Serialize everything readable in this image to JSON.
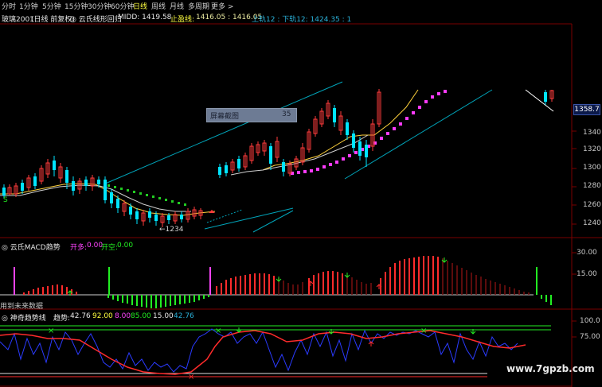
{
  "menu": {
    "items": [
      "分时",
      "1分钟",
      "5分钟",
      "15分钟",
      "30分钟",
      "60分钟",
      "日线",
      "周线",
      "月线",
      "多周期",
      "更多 >"
    ],
    "active": "日线"
  },
  "title_row": {
    "symbol": "玻璃2001",
    "period": "(日线 前复权)",
    "indicator": "◎ 云氏线形回归",
    "midd": "MIDD: 1419.58",
    "stop_label": "止盈线:",
    "stop_values": "1416.05 : 1416.05",
    "upper_rail": "上轨12 : 下轨12: 1424.35 : 1"
  },
  "price_axis": {
    "ticks": [
      "1340",
      "1320",
      "1300",
      "1280",
      "1260",
      "1240"
    ],
    "current_price": "1358.7"
  },
  "screenshot_popup": {
    "label": "屏幕截图",
    "count": "35"
  },
  "price_chart": {
    "low_label": "←1234",
    "signal_label": "S",
    "colors": {
      "up": "#ff3b3b",
      "down": "#00e5ff",
      "channel": "#00a3b8",
      "upper_dots": "#ff3bff",
      "lower_dots": "#22cc22",
      "midline": "#ffd23c"
    }
  },
  "macd_panel": {
    "title": "◎ 云氏MACD趋势",
    "open_long_label": "开多:",
    "open_long_value": "0.00",
    "open_short_label": "开空:",
    "open_short_value": "0.00",
    "future_data_note": "用到未来数据",
    "ticks": [
      "30.00",
      "15.00"
    ],
    "colors": {
      "pos": "#ff2b2b",
      "neg": "#22ee22",
      "spike": "#ff44ff"
    }
  },
  "trend_panel": {
    "title": "◎ 神奇趋势线",
    "trend_label": "趋势:",
    "trend_value": "42.76",
    "v1": "92.00",
    "v2": "8.00",
    "v3": "85.00",
    "v4": "15.00",
    "v5": "42.76",
    "ticks": [
      "100.0",
      "75.00"
    ]
  },
  "watermark": "www.7gpzb.com"
}
